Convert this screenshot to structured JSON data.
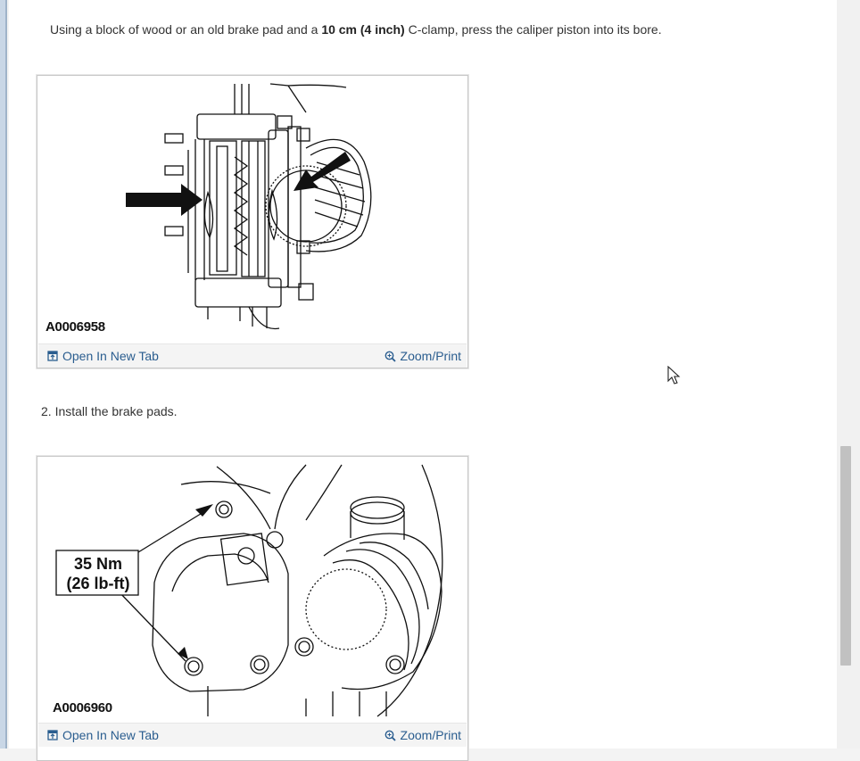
{
  "step_intro": {
    "prefix": "Using a block of wood or an old brake pad and a ",
    "measure": "10 cm (4 inch)",
    "suffix": " C-clamp, press the caliper piston into its bore."
  },
  "figure1": {
    "id": "A0006958",
    "open_label": "Open In New Tab",
    "zoom_label": "Zoom/Print"
  },
  "step2": {
    "text": "2. Install the brake pads."
  },
  "figure2": {
    "id": "A0006960",
    "torque_nm": "35 Nm",
    "torque_lbft": "(26 lb-ft)",
    "open_label": "Open In New Tab",
    "zoom_label": "Zoom/Print"
  }
}
